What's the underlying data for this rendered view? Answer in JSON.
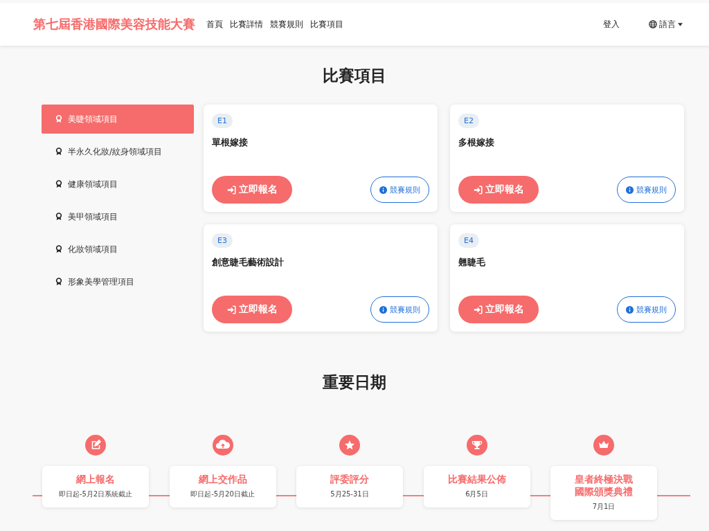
{
  "header": {
    "brand": "第七屆香港國際美容技能大賽",
    "nav": [
      "首頁",
      "比賽詳情",
      "競賽規則",
      "比賽項目"
    ],
    "login": "登入",
    "language": "語言"
  },
  "projects": {
    "title": "比賽項目",
    "categories": [
      {
        "label": "美睫領域項目",
        "selected": true
      },
      {
        "label": "半永久化妝/紋身領域項目",
        "selected": false
      },
      {
        "label": "健康領域項目",
        "selected": false
      },
      {
        "label": "美甲領域項目",
        "selected": false
      },
      {
        "label": "化妝領域項目",
        "selected": false
      },
      {
        "label": "形象美學管理項目",
        "selected": false
      }
    ],
    "cards": [
      {
        "code": "E1",
        "name": "單根嫁接",
        "register": "立即報名",
        "rules": "競賽規則"
      },
      {
        "code": "E2",
        "name": "多根嫁接",
        "register": "立即報名",
        "rules": "競賽規則"
      },
      {
        "code": "E3",
        "name": "創意睫毛藝術設計",
        "register": "立即報名",
        "rules": "競賽規則"
      },
      {
        "code": "E4",
        "name": "翹睫毛",
        "register": "立即報名",
        "rules": "競賽規則"
      }
    ]
  },
  "dates": {
    "title": "重要日期",
    "items": [
      {
        "kind": "edit",
        "title_lines": [
          "網上報名"
        ],
        "date": "即日起-5月2日系統截止"
      },
      {
        "kind": "upload",
        "title_lines": [
          "網上交作品"
        ],
        "date": "即日起-5月20日截止"
      },
      {
        "kind": "star",
        "title_lines": [
          "評委評分"
        ],
        "date": "5月25-31日"
      },
      {
        "kind": "trophy",
        "title_lines": [
          "比賽結果公佈"
        ],
        "date": "6月5日"
      },
      {
        "kind": "crown",
        "title_lines": [
          "皇者終極決戰",
          "國際頒獎典禮"
        ],
        "date": "7月1日"
      }
    ]
  }
}
